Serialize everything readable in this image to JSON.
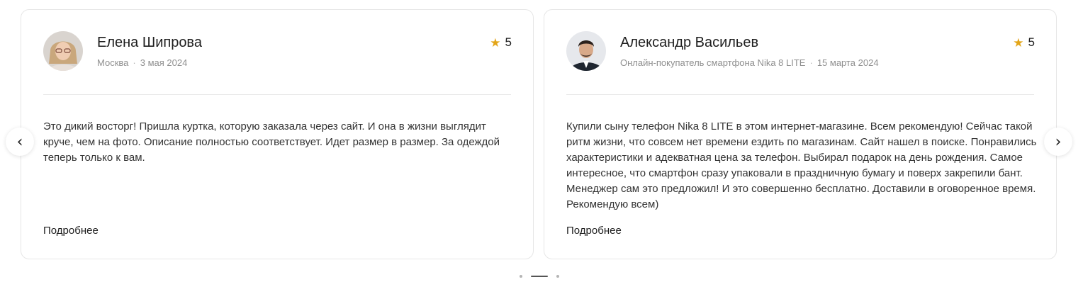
{
  "colors": {
    "star": "#e3a518",
    "border": "#e6e6e6",
    "meta_text": "#8f8f8f"
  },
  "reviews": [
    {
      "name": "Елена Шипрова",
      "city": "Москва",
      "date": "3 мая 2024",
      "rating": "5",
      "text": "Это дикий восторг! Пришла куртка, которую заказала через сайт. И она в жизни выглядит круче, чем на фото. Описание полностью соответствует. Идет размер в размер. За одеждой теперь только к вам.",
      "more_label": "Подробнее"
    },
    {
      "name": "Александр Васильев",
      "city": "Онлайн-покупатель смартфона Nika 8 LITE",
      "date": "15 марта 2024",
      "rating": "5",
      "text": "Купили сыну телефон Nika 8 LITE в этом интернет-магазине. Всем рекомендую! Сейчас такой ритм жизни, что совсем нет времени ездить по магазинам. Сайт нашел в поиске. Понравились характеристики и адекватная цена за телефон. Выбирал подарок на день рождения. Самое интересное, что смартфон сразу упаковали в праздничную бумагу и поверх закрепили бант. Менеджер сам это предложил! И это совершенно бесплатно. Доставили в оговоренное время. Рекомендую всем)",
      "more_label": "Подробнее"
    }
  ],
  "nav": {
    "prev_icon": "‹",
    "next_icon": "›"
  },
  "pagination": {
    "count": 3,
    "active": 2
  }
}
